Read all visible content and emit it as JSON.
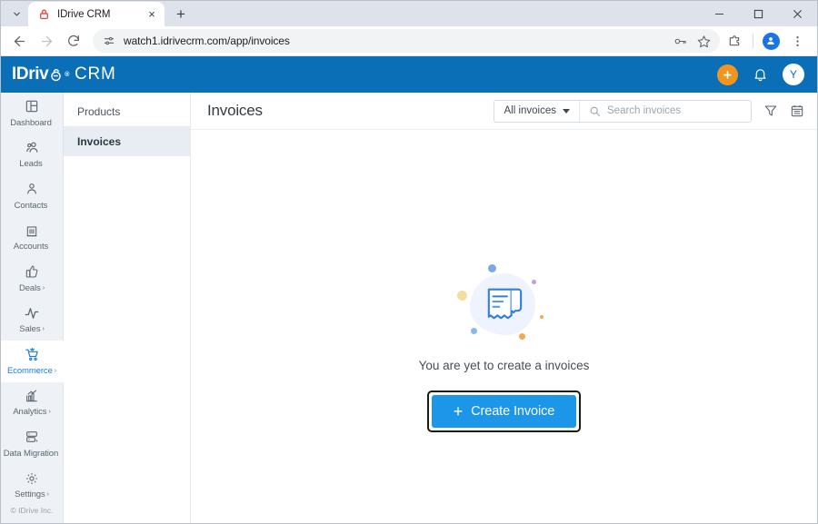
{
  "browser": {
    "tab": {
      "title": "IDrive CRM",
      "favicon": "lock-icon",
      "close": "×"
    },
    "new_tab": "+",
    "tab_list": "chevron-down-icon",
    "window_controls": {
      "minimize": "−",
      "maximize": "□",
      "close": "×"
    },
    "nav": {
      "back": "←",
      "forward": "→",
      "reload": "⟳"
    },
    "omnibox": {
      "url": "watch1.idrivecrm.com/app/invoices",
      "site_icon": "tune-icon",
      "password_icon": "key-icon",
      "bookmark_icon": "star-icon"
    },
    "extensions_icon": "extensions-icon",
    "profile_icon": "profile-avatar-icon",
    "menu_icon": "three-dots-menu-icon"
  },
  "app_header": {
    "logo_text": "IDriv",
    "logo_mark": "e",
    "logo_reg": "®",
    "logo_suffix": "CRM",
    "add_button": "+",
    "notifications_icon": "bell-icon",
    "user_initial": "Y"
  },
  "sidebar": {
    "items": [
      {
        "label": "Dashboard",
        "icon": "dashboard-icon",
        "caret": "",
        "active": false
      },
      {
        "label": "Leads",
        "icon": "leads-icon",
        "caret": "",
        "active": false
      },
      {
        "label": "Contacts",
        "icon": "contacts-icon",
        "caret": "",
        "active": false
      },
      {
        "label": "Accounts",
        "icon": "accounts-icon",
        "caret": "",
        "active": false
      },
      {
        "label": "Deals",
        "icon": "deals-thumbsup-icon",
        "caret": "›",
        "active": false
      },
      {
        "label": "Sales",
        "icon": "sales-pulse-icon",
        "caret": "›",
        "active": false
      },
      {
        "label": "Ecommerce",
        "icon": "cart-icon",
        "caret": "›",
        "active": true
      },
      {
        "label": "Analytics",
        "icon": "analytics-chart-icon",
        "caret": "›",
        "active": false
      },
      {
        "label": "Data Migration",
        "icon": "database-icon",
        "caret": "",
        "active": false
      },
      {
        "label": "Settings",
        "icon": "gear-icon",
        "caret": "›",
        "active": false
      }
    ],
    "footer": "© IDrive Inc."
  },
  "subnav": {
    "items": [
      {
        "label": "Products",
        "active": false
      },
      {
        "label": "Invoices",
        "active": true
      }
    ]
  },
  "content": {
    "title": "Invoices",
    "filter_label": "All invoices",
    "search_placeholder": "Search invoices",
    "search_value": "",
    "search_icon": "search-icon",
    "filter_icon": "funnel-filter-icon",
    "calendar_icon": "calendar-icon",
    "empty": {
      "illustration": "invoice-receipt-illustration",
      "message": "You are yet to create a invoices",
      "button_label": "Create Invoice",
      "button_plus": "+"
    }
  },
  "colors": {
    "app_header_blue": "#0b6fb8",
    "accent_blue": "#1b96e8",
    "active_nav_blue": "#1b7fd4",
    "orange_add": "#f2941f",
    "sidebar_bg": "#eef2f6",
    "subnav_active": "#e7edf3",
    "blob": "#eef3fd",
    "dot_blue": "#7aa9e8",
    "dot_light_blue": "#89b8ef",
    "dot_yellow": "#f2dfa0",
    "dot_purple": "#c79ae8",
    "dot_orange": "#f5a84e"
  }
}
